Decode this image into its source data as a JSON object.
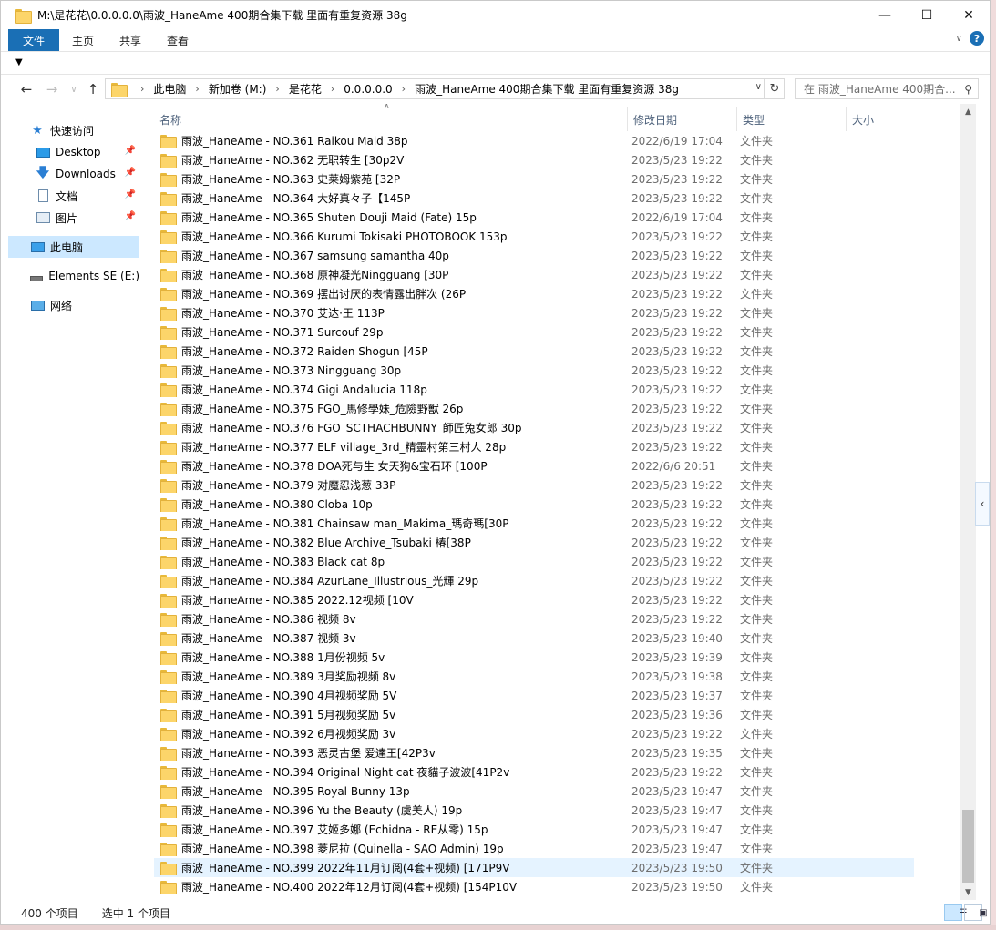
{
  "window": {
    "title": "M:\\是花花\\0.0.0.0.0\\雨波_HaneAme 400期合集下载 里面有重复资源 38g",
    "min_icon": "minimize-icon",
    "max_icon": "maximize-icon",
    "close_icon": "close-icon"
  },
  "ribbon": {
    "tabs": [
      "文件",
      "主页",
      "共享",
      "查看"
    ]
  },
  "address": {
    "crumbs": [
      "此电脑",
      "新加卷 (M:)",
      "是花花",
      "0.0.0.0.0",
      "雨波_HaneAme 400期合集下载 里面有重复资源 38g"
    ],
    "search_placeholder": "在 雨波_HaneAme 400期合..."
  },
  "sidebar": {
    "items": [
      {
        "label": "快速访问",
        "icon": "star-icon"
      },
      {
        "label": "Desktop",
        "icon": "desktop-icon"
      },
      {
        "label": "Downloads",
        "icon": "download-icon"
      },
      {
        "label": "文档",
        "icon": "document-icon"
      },
      {
        "label": "图片",
        "icon": "picture-icon"
      },
      {
        "label": "此电脑",
        "icon": "computer-icon"
      },
      {
        "label": "Elements SE (E:)",
        "icon": "drive-icon"
      },
      {
        "label": "网络",
        "icon": "network-icon"
      }
    ]
  },
  "columns": {
    "name": "名称",
    "date": "修改日期",
    "type": "类型",
    "size": "大小"
  },
  "files": [
    {
      "name": "雨波_HaneAme - NO.361 Raikou Maid 38p",
      "date": "2022/6/19 17:04",
      "type": "文件夹"
    },
    {
      "name": "雨波_HaneAme - NO.362 无职转生 [30p2V",
      "date": "2023/5/23 19:22",
      "type": "文件夹"
    },
    {
      "name": "雨波_HaneAme - NO.363 史莱姆紫苑 [32P",
      "date": "2023/5/23 19:22",
      "type": "文件夹"
    },
    {
      "name": "雨波_HaneAme - NO.364 大好真々子【145P",
      "date": "2023/5/23 19:22",
      "type": "文件夹"
    },
    {
      "name": "雨波_HaneAme - NO.365 Shuten Douji Maid (Fate) 15p",
      "date": "2022/6/19 17:04",
      "type": "文件夹"
    },
    {
      "name": "雨波_HaneAme - NO.366 Kurumi Tokisaki PHOTOBOOK 153p",
      "date": "2023/5/23 19:22",
      "type": "文件夹"
    },
    {
      "name": "雨波_HaneAme - NO.367 samsung samantha 40p",
      "date": "2023/5/23 19:22",
      "type": "文件夹"
    },
    {
      "name": "雨波_HaneAme - NO.368 原神凝光Ningguang [30P",
      "date": "2023/5/23 19:22",
      "type": "文件夹"
    },
    {
      "name": "雨波_HaneAme - NO.369 摆出讨厌的表情露出胖次 (26P",
      "date": "2023/5/23 19:22",
      "type": "文件夹"
    },
    {
      "name": "雨波_HaneAme - NO.370 艾达·王 113P",
      "date": "2023/5/23 19:22",
      "type": "文件夹"
    },
    {
      "name": "雨波_HaneAme - NO.371 Surcouf 29p",
      "date": "2023/5/23 19:22",
      "type": "文件夹"
    },
    {
      "name": "雨波_HaneAme - NO.372 Raiden Shogun [45P",
      "date": "2023/5/23 19:22",
      "type": "文件夹"
    },
    {
      "name": "雨波_HaneAme - NO.373 Ningguang 30p",
      "date": "2023/5/23 19:22",
      "type": "文件夹"
    },
    {
      "name": "雨波_HaneAme - NO.374 Gigi Andalucia 118p",
      "date": "2023/5/23 19:22",
      "type": "文件夹"
    },
    {
      "name": "雨波_HaneAme - NO.375 FGO_馬修學妹_危險野獸 26p",
      "date": "2023/5/23 19:22",
      "type": "文件夹"
    },
    {
      "name": "雨波_HaneAme - NO.376 FGO_SCTHACHBUNNY_師匠兔女郎 30p",
      "date": "2023/5/23 19:22",
      "type": "文件夹"
    },
    {
      "name": "雨波_HaneAme - NO.377 ELF village_3rd_精靈村第三村人 28p",
      "date": "2023/5/23 19:22",
      "type": "文件夹"
    },
    {
      "name": "雨波_HaneAme - NO.378 DOA死与生 女天狗&宝石环 [100P",
      "date": "2022/6/6 20:51",
      "type": "文件夹"
    },
    {
      "name": "雨波_HaneAme - NO.379 对魔忍浅葱 33P",
      "date": "2023/5/23 19:22",
      "type": "文件夹"
    },
    {
      "name": "雨波_HaneAme - NO.380 Cloba 10p",
      "date": "2023/5/23 19:22",
      "type": "文件夹"
    },
    {
      "name": "雨波_HaneAme - NO.381 Chainsaw man_Makima_瑪奇瑪[30P",
      "date": "2023/5/23 19:22",
      "type": "文件夹"
    },
    {
      "name": "雨波_HaneAme - NO.382 Blue Archive_Tsubaki 椿[38P",
      "date": "2023/5/23 19:22",
      "type": "文件夹"
    },
    {
      "name": "雨波_HaneAme - NO.383 Black cat 8p",
      "date": "2023/5/23 19:22",
      "type": "文件夹"
    },
    {
      "name": "雨波_HaneAme - NO.384 AzurLane_Illustrious_光輝 29p",
      "date": "2023/5/23 19:22",
      "type": "文件夹"
    },
    {
      "name": "雨波_HaneAme - NO.385 2022.12视频 [10V",
      "date": "2023/5/23 19:22",
      "type": "文件夹"
    },
    {
      "name": "雨波_HaneAme - NO.386 视频 8v",
      "date": "2023/5/23 19:22",
      "type": "文件夹"
    },
    {
      "name": "雨波_HaneAme - NO.387 视频 3v",
      "date": "2023/5/23 19:40",
      "type": "文件夹"
    },
    {
      "name": "雨波_HaneAme - NO.388 1月份视频 5v",
      "date": "2023/5/23 19:39",
      "type": "文件夹"
    },
    {
      "name": "雨波_HaneAme - NO.389 3月奖励视频 8v",
      "date": "2023/5/23 19:38",
      "type": "文件夹"
    },
    {
      "name": "雨波_HaneAme - NO.390 4月视频奖励 5V",
      "date": "2023/5/23 19:37",
      "type": "文件夹"
    },
    {
      "name": "雨波_HaneAme - NO.391 5月视频奖励 5v",
      "date": "2023/5/23 19:36",
      "type": "文件夹"
    },
    {
      "name": "雨波_HaneAme - NO.392 6月视频奖励 3v",
      "date": "2023/5/23 19:22",
      "type": "文件夹"
    },
    {
      "name": "雨波_HaneAme - NO.393 恶灵古堡 爱達王[42P3v",
      "date": "2023/5/23 19:35",
      "type": "文件夹"
    },
    {
      "name": "雨波_HaneAme - NO.394 Original Night cat 夜貓子波波[41P2v",
      "date": "2023/5/23 19:22",
      "type": "文件夹"
    },
    {
      "name": "雨波_HaneAme - NO.395 Royal Bunny 13p",
      "date": "2023/5/23 19:47",
      "type": "文件夹"
    },
    {
      "name": "雨波_HaneAme - NO.396 Yu the Beauty (虞美人) 19p",
      "date": "2023/5/23 19:47",
      "type": "文件夹"
    },
    {
      "name": "雨波_HaneAme - NO.397 艾姬多娜 (Echidna - RE从零) 15p",
      "date": "2023/5/23 19:47",
      "type": "文件夹"
    },
    {
      "name": "雨波_HaneAme - NO.398 菱尼拉 (Quinella - SAO Admin) 19p",
      "date": "2023/5/23 19:47",
      "type": "文件夹"
    },
    {
      "name": "雨波_HaneAme - NO.399 2022年11月订阅(4套+视频) [171P9V",
      "date": "2023/5/23 19:50",
      "type": "文件夹",
      "selected": true
    },
    {
      "name": "雨波_HaneAme - NO.400 2022年12月订阅(4套+视频) [154P10V",
      "date": "2023/5/23 19:50",
      "type": "文件夹"
    }
  ],
  "status": {
    "count": "400 个项目",
    "selected": "选中 1 个项目"
  }
}
